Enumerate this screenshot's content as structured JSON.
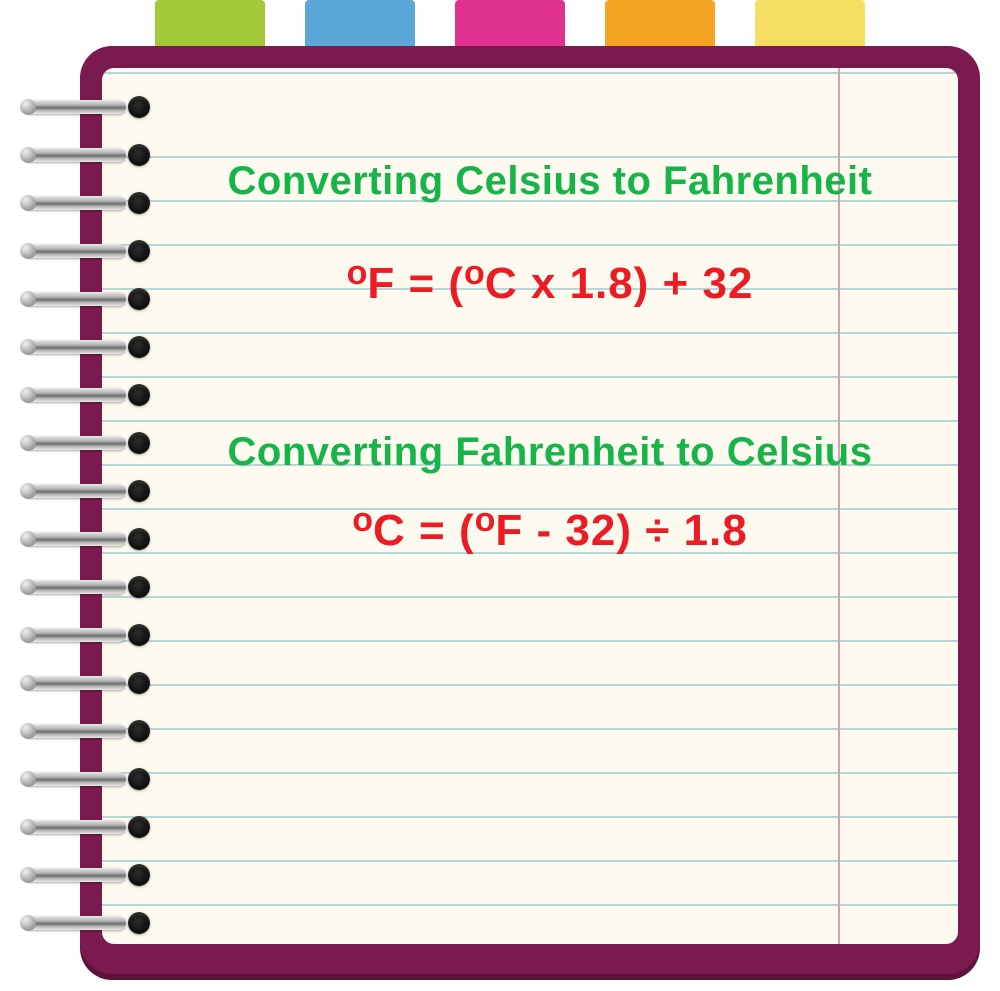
{
  "tabs": {
    "colors": [
      "#a3c93b",
      "#5aa6d6",
      "#e0318f",
      "#f4a524",
      "#f5df62"
    ]
  },
  "section1": {
    "title": "Converting Celsius to Fahrenheit",
    "deg1": "o",
    "unit1": "F",
    "mid": " = (",
    "deg2": "o",
    "unit2": "C",
    "rest": " x 1.8) + 32"
  },
  "section2": {
    "title": "Converting Fahrenheit to Celsius",
    "deg1": "o",
    "unit1": "C",
    "mid": " = (",
    "deg2": "o",
    "unit2": "F",
    "rest": " - 32) ÷ 1.8"
  }
}
